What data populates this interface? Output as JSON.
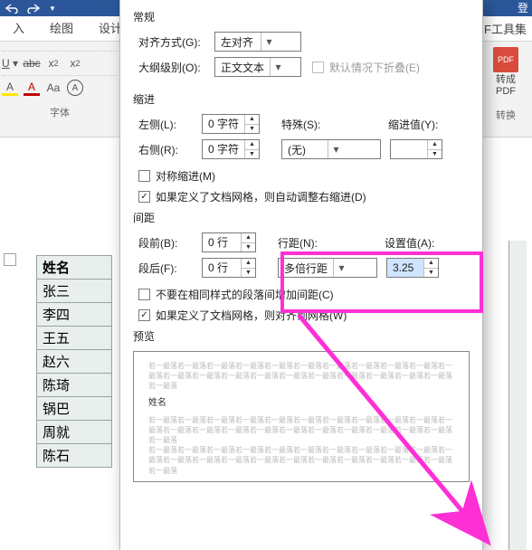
{
  "titlebar": {
    "login": "登"
  },
  "tabs": {
    "left1": "入",
    "left2": "绘图",
    "left3": "设计",
    "right1": "F工具集"
  },
  "ribbon": {
    "font_group_label": "字体",
    "u_label": "U",
    "abc_label": "abc",
    "x2_label": "x",
    "x2_sub": "2",
    "x2_sup": "2",
    "a_label": "A",
    "aa_label": "Aa",
    "aenc": "A",
    "pdf_line1": "转成",
    "pdf_line2": "PDF",
    "convert_label": "转换"
  },
  "dialog": {
    "general_label": "常规",
    "alignment_label": "对齐方式(G):",
    "alignment_value": "左对齐",
    "outline_label": "大纲级别(O):",
    "outline_value": "正文文本",
    "collapse_label": "默认情况下折叠(E)",
    "indent_label": "缩进",
    "left_label": "左侧(L):",
    "left_value": "0 字符",
    "right_label": "右侧(R):",
    "right_value": "0 字符",
    "special_label": "特殊(S):",
    "special_value": "(无)",
    "indentval_label": "缩进值(Y):",
    "mirror_label": "对称缩进(M)",
    "autogrid_label": "如果定义了文档网格，则自动调整右缩进(D)",
    "spacing_label": "间距",
    "before_label": "段前(B):",
    "before_value": "0 行",
    "after_label": "段后(F):",
    "after_value": "0 行",
    "linespacing_label": "行距(N):",
    "linespacing_value": "多倍行距",
    "setvalue_label": "设置值(A):",
    "setvalue_value": "3.25",
    "nospacing_label": "不要在相同样式的段落间增加间距(C)",
    "snapgrid_label": "如果定义了文档网格，则对齐到网格(W)",
    "preview_label": "预览",
    "preview_lorem": "若一最落若一最落若一最落若一最落若一最落若一最落若一最落若一最落若一最落若一最落若一最落若一最落若一最落若一最落若一最落若一最落若一最落若一最落若一最落若一最落若一最落若一最落",
    "preview_sample": "姓名"
  },
  "table": {
    "header": "姓名",
    "rows": [
      "张三",
      "李四",
      "王五",
      "赵六",
      "陈琦",
      "锅巴",
      "周就",
      "陈石"
    ]
  }
}
